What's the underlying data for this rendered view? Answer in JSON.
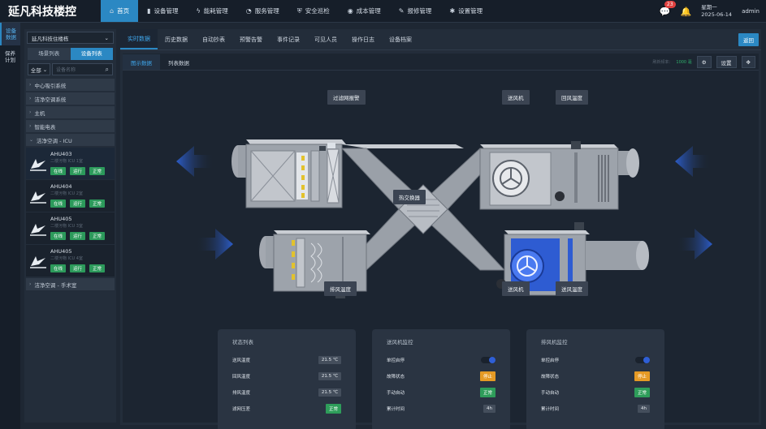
{
  "brand": "延凡科技楼控",
  "nav": [
    {
      "label": "首页",
      "icon": "home-icon",
      "glyph": "⌂",
      "active": true
    },
    {
      "label": "设备管理",
      "icon": "device-icon",
      "glyph": "▮"
    },
    {
      "label": "能耗管理",
      "icon": "energy-icon",
      "glyph": "ϟ"
    },
    {
      "label": "服务管理",
      "icon": "service-icon",
      "glyph": "◔"
    },
    {
      "label": "安全巡检",
      "icon": "shield-icon",
      "glyph": "⛨"
    },
    {
      "label": "成本管理",
      "icon": "cost-icon",
      "glyph": "◉"
    },
    {
      "label": "报修管理",
      "icon": "wrench-icon",
      "glyph": "✎"
    },
    {
      "label": "设置管理",
      "icon": "settings-icon",
      "glyph": "✱"
    }
  ],
  "top_right": {
    "message_count": "23",
    "weekday": "星期一",
    "date": "2025-06-14",
    "user": "admin"
  },
  "rail": [
    {
      "label": "设备\n数据",
      "active": true
    },
    {
      "label": "保养\n计划"
    }
  ],
  "side": {
    "building_select": "延凡科技住楼栋",
    "tabs": [
      {
        "label": "场景列表"
      },
      {
        "label": "设备列表",
        "active": true
      }
    ],
    "filter": "全部",
    "search_placeholder": "设备名称",
    "groups": [
      "中心吸引系统",
      "洁净空调系统",
      "主机",
      "智能电表"
    ],
    "expanded_group": "洁净空调 - ICU",
    "units": [
      {
        "name": "AHU403",
        "sub": "二楼污物 ICU 1室",
        "tags": [
          "在线",
          "运行",
          "正常"
        ]
      },
      {
        "name": "AHU404",
        "sub": "二楼污物 ICU 2室",
        "tags": [
          "在线",
          "运行",
          "正常"
        ]
      },
      {
        "name": "AHU405",
        "sub": "二楼污物 ICU 3室",
        "tags": [
          "在线",
          "运行",
          "正常"
        ]
      },
      {
        "name": "AHU405",
        "sub": "二楼污物 ICU 4室",
        "tags": [
          "在线",
          "运行",
          "正常"
        ]
      }
    ],
    "last_group": "洁净空调 - 手术室"
  },
  "main": {
    "tabs": [
      "实时数据",
      "历史数据",
      "自动抄表",
      "预警告警",
      "事件记录",
      "可见人员",
      "操作日志",
      "设备档案"
    ],
    "back": "返回",
    "inner_tabs": [
      "图示数据",
      "列表数据"
    ],
    "refresh_label": "刷新频率：",
    "refresh_value": "1000 毫",
    "settings_label": "设置"
  },
  "diagram_labels": {
    "filter_alarm": "过滤网报警",
    "supply_fan_top": "送风机",
    "return_temp": "回风温度",
    "heat_exchanger": "热交换器",
    "exhaust_temp": "排风温度",
    "supply_fan_bottom": "送风机",
    "supply_temp": "送风温度"
  },
  "cards": {
    "status": {
      "title": "状态列表",
      "rows": [
        {
          "label": "送风温度",
          "value": "21.5 ℃"
        },
        {
          "label": "回风温度",
          "value": "21.5 ℃"
        },
        {
          "label": "排风温度",
          "value": "21.5 ℃"
        },
        {
          "label": "滤网压差",
          "value": "正常"
        }
      ]
    },
    "supply": {
      "title": "送风机监控",
      "rows": [
        {
          "label": "单控启停"
        },
        {
          "label": "故障状态",
          "value": "停止"
        },
        {
          "label": "手动自动",
          "value": "正常"
        },
        {
          "label": "累计时间",
          "value": "4h"
        }
      ]
    },
    "exhaust": {
      "title": "排风机监控",
      "rows": [
        {
          "label": "单控启停"
        },
        {
          "label": "故障状态",
          "value": "停止"
        },
        {
          "label": "手动自动",
          "value": "正常"
        },
        {
          "label": "累计时间",
          "value": "4h"
        }
      ]
    }
  },
  "colors": {
    "accent": "#2b88c3",
    "ok": "#2e9d5a",
    "warn": "#e59a25",
    "fan_blue": "#2f5fd6"
  }
}
